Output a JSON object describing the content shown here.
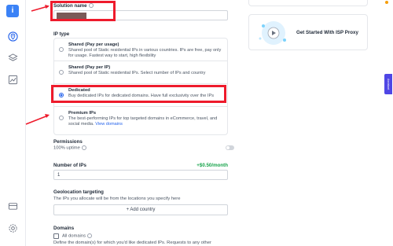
{
  "sidebar": {
    "logo_char": "i",
    "icons": [
      "location-pin-icon",
      "layers-icon",
      "chart-icon",
      "card-icon",
      "gear-icon"
    ]
  },
  "form": {
    "solution_name_label": "Solution name",
    "ip_type_label": "IP type",
    "options": [
      {
        "title": "Shared (Pay per usage)",
        "desc": "Shared pool of Static residential IPs in various countries. IPs are free, pay only for usage. Fastest way to start, high flexibility",
        "selected": false
      },
      {
        "title": "Shared (Pay per IP)",
        "desc": "Shared pool of Static residential IPs. Select number of IPs and country",
        "selected": false
      },
      {
        "title": "Dedicated",
        "desc": "Buy dedicated IPs for dedicated domains. Have full exclusivity over the IPs",
        "selected": true
      },
      {
        "title": "Premium IPs",
        "desc": "The best-performing IPs for top targeted domains in eCommerce, travel, and social media.",
        "link": "View domains",
        "selected": false
      }
    ],
    "permissions_label": "Permissions",
    "uptime_label": "100% uptime",
    "num_ips_label": "Number of IPs",
    "price": "+$0.50/month",
    "num_ips_value": "1",
    "geo_label": "Geolocation targeting",
    "geo_sub": "The IPs you allocate will be from the locations you specify here",
    "add_country": "+ Add country",
    "domains_label": "Domains",
    "all_domains": "All domains",
    "domains_sub": "Define the domain(s) for which you'd like dedicated IPs. Requests to any other"
  },
  "right": {
    "card_title": "Get Started With ISP Proxy",
    "side_tab": "Assistant"
  },
  "colors": {
    "accent": "#2563eb",
    "highlight": "#ee1b2c",
    "price": "#16a34a"
  }
}
